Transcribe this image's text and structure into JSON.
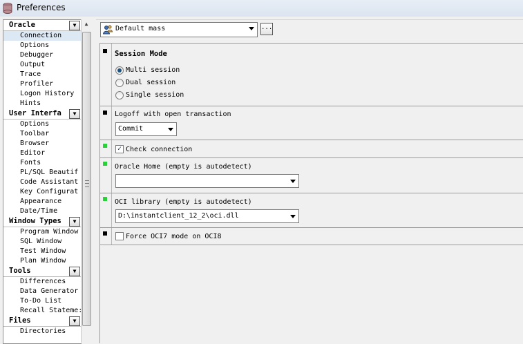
{
  "window": {
    "title": "Preferences"
  },
  "tree": {
    "groups": [
      {
        "header": "Oracle",
        "items": [
          "Connection",
          "Options",
          "Debugger",
          "Output",
          "Trace",
          "Profiler",
          "Logon History",
          "Hints"
        ],
        "selected": 0
      },
      {
        "header": "User Interfa",
        "items": [
          "Options",
          "Toolbar",
          "Browser",
          "Editor",
          "Fonts",
          "PL/SQL Beautif",
          "Code Assistant",
          "Key Configurat",
          "Appearance",
          "Date/Time"
        ]
      },
      {
        "header": "Window Types",
        "items": [
          "Program Window",
          "SQL Window",
          "Test Window",
          "Plan Window"
        ]
      },
      {
        "header": "Tools",
        "items": [
          "Differences",
          "Data Generator",
          "To-Do List",
          "Recall Stateme:"
        ]
      },
      {
        "header": "Files",
        "items": [
          "Directories"
        ]
      }
    ]
  },
  "profile": {
    "value": "Default mass",
    "more_label": "..."
  },
  "session_mode": {
    "heading": "Session Mode",
    "options": [
      "Multi session",
      "Dual session",
      "Single session"
    ],
    "selected": "Multi session"
  },
  "logoff": {
    "label": "Logoff with open transaction",
    "value": "Commit"
  },
  "check_connection": {
    "label": "Check connection",
    "checked": true
  },
  "oracle_home": {
    "label": "Oracle Home (empty is autodetect)",
    "value": ""
  },
  "oci_library": {
    "label": "OCI library (empty is autodetect)",
    "value": "D:\\instantclient_12_2\\oci.dll"
  },
  "force_oci7": {
    "label": "Force OCI7 mode on OCI8",
    "checked": false
  },
  "colors": {
    "modified_marker": "#2ad23a",
    "default_marker": "#000000",
    "selection": "#dde8f5"
  }
}
